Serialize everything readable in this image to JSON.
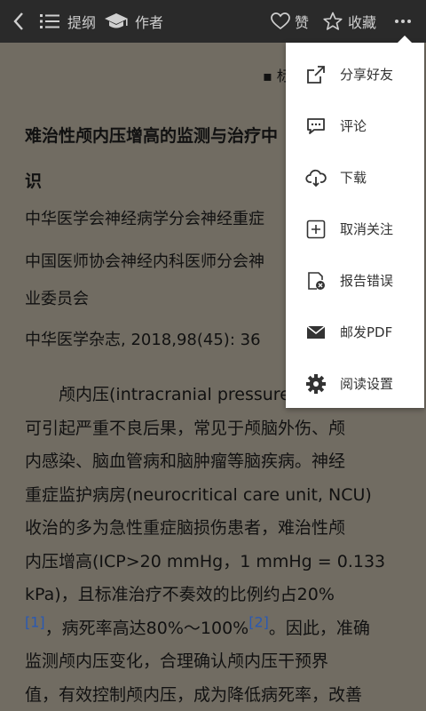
{
  "topbar": {
    "outline_label": "提纲",
    "author_label": "作者",
    "like_label": "赞",
    "favorite_label": "收藏"
  },
  "article": {
    "tagline": "▪ 标",
    "title_line1": "难治性颅内压增高的监测与治疗中",
    "title_line2": "识",
    "author_line1": "中华医学会神经病学分会神经重症",
    "author_line2": "中国医师协会神经内科医师分会神",
    "author_line3": "业委员会",
    "source": "中华医学杂志, 2018,98(45): 36",
    "body": [
      "　　颅内压(intracranial pressure",
      "可引起严重不良后果，常见于颅脑外伤、颅",
      "内感染、脑血管病和脑肿瘤等脑疾病。神经",
      "重症监护病房(neurocritical care unit, NCU)",
      "收治的多为急性重症脑损伤患者，难治性颅",
      "内压增高(ICP>20 mmHg，1 mmHg = 0.133",
      "kPa)，且标准治疗不奏效的比例约占20%"
    ],
    "ref_line": {
      "ref1": "[1]",
      "mid": "，病死率高达80%～100%",
      "ref2": "[2]",
      "tail": "。因此，准确"
    },
    "body_after": [
      "监测颅内压变化，合理确认颅内压干预界",
      "值，有效控制颅内压，成为降低病死率，改善"
    ]
  },
  "menu": {
    "items": [
      {
        "label": "分享好友",
        "icon": "share-icon"
      },
      {
        "label": "评论",
        "icon": "comment-icon"
      },
      {
        "label": "下载",
        "icon": "download-icon"
      },
      {
        "label": "取消关注",
        "icon": "unfollow-icon"
      },
      {
        "label": "报告错误",
        "icon": "report-error-icon"
      },
      {
        "label": "邮发PDF",
        "icon": "mail-icon"
      },
      {
        "label": "阅读设置",
        "icon": "settings-icon"
      }
    ]
  }
}
